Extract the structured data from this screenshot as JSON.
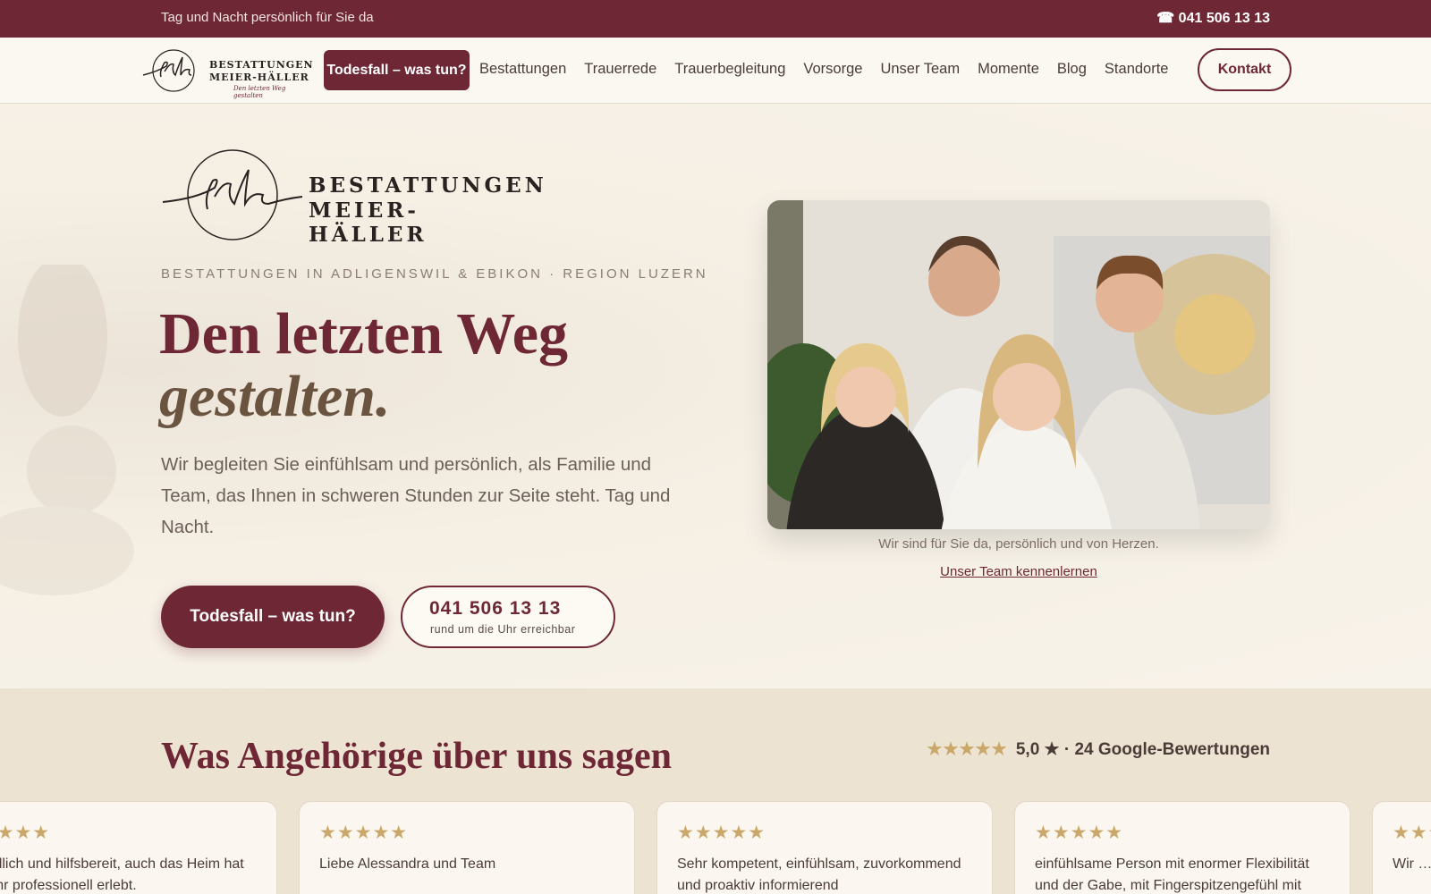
{
  "topbar": {
    "tagline": "Tag und Nacht persönlich für Sie da",
    "phone": "☎ 041 506 13 13"
  },
  "nav": {
    "logo": {
      "line1": "BESTATTUNGEN",
      "line2": "MEIER-HÄLLER",
      "slogan": "Den letzten Weg gestalten"
    },
    "cta": "Todesfall – was tun?",
    "links": [
      "Bestattungen",
      "Trauerrede",
      "Trauerbegleitung",
      "Vorsorge",
      "Unser Team",
      "Momente",
      "Blog",
      "Standorte"
    ],
    "contact": "Kontakt"
  },
  "hero": {
    "logo": {
      "line1": "BESTATTUNGEN",
      "line2": "MEIER-HÄLLER"
    },
    "eyebrow": "BESTATTUNGEN IN ADLIGENSWIL & EBIKON · REGION LUZERN",
    "headline_line1": "Den letzten Weg",
    "headline_line2": "gestalten.",
    "lead": "Wir begleiten Sie einfühlsam und persönlich, als Familie und Team, das Ihnen in schweren Stunden zur Seite steht. Tag und Nacht.",
    "primary_button": "Todesfall – was tun?",
    "phone_button": {
      "number": "041 506 13 13",
      "subtitle": "rund um die Uhr erreichbar"
    },
    "photo_caption": "Wir sind für Sie da, persönlich und von Herzen.",
    "team_link": "Unser Team kennenlernen"
  },
  "reviews": {
    "title": "Was Angehörige über uns sagen",
    "rating_stars": "★★★★★",
    "rating_text": "5,0 ★ · 24 Google-Bewertungen",
    "cards": [
      {
        "stars": "★★★★★",
        "text": "freundlich und hilfsbereit, auch das Heim hat es sehr professionell erlebt."
      },
      {
        "stars": "★★★★★",
        "text": "Liebe Alessandra und Team"
      },
      {
        "stars": "★★★★★",
        "text": "Sehr kompetent, einfühlsam, zuvorkommend und proaktiv informierend"
      },
      {
        "stars": "★★★★★",
        "text": "einfühlsame Person mit enormer Flexibilität und der Gabe, mit Fingerspitzengefühl mit"
      },
      {
        "stars": "★★★★★",
        "text": "Wir … Best…"
      }
    ]
  },
  "colors": {
    "brand": "#6e2835",
    "gold": "#c9a86a",
    "background": "#f7f2e9"
  }
}
